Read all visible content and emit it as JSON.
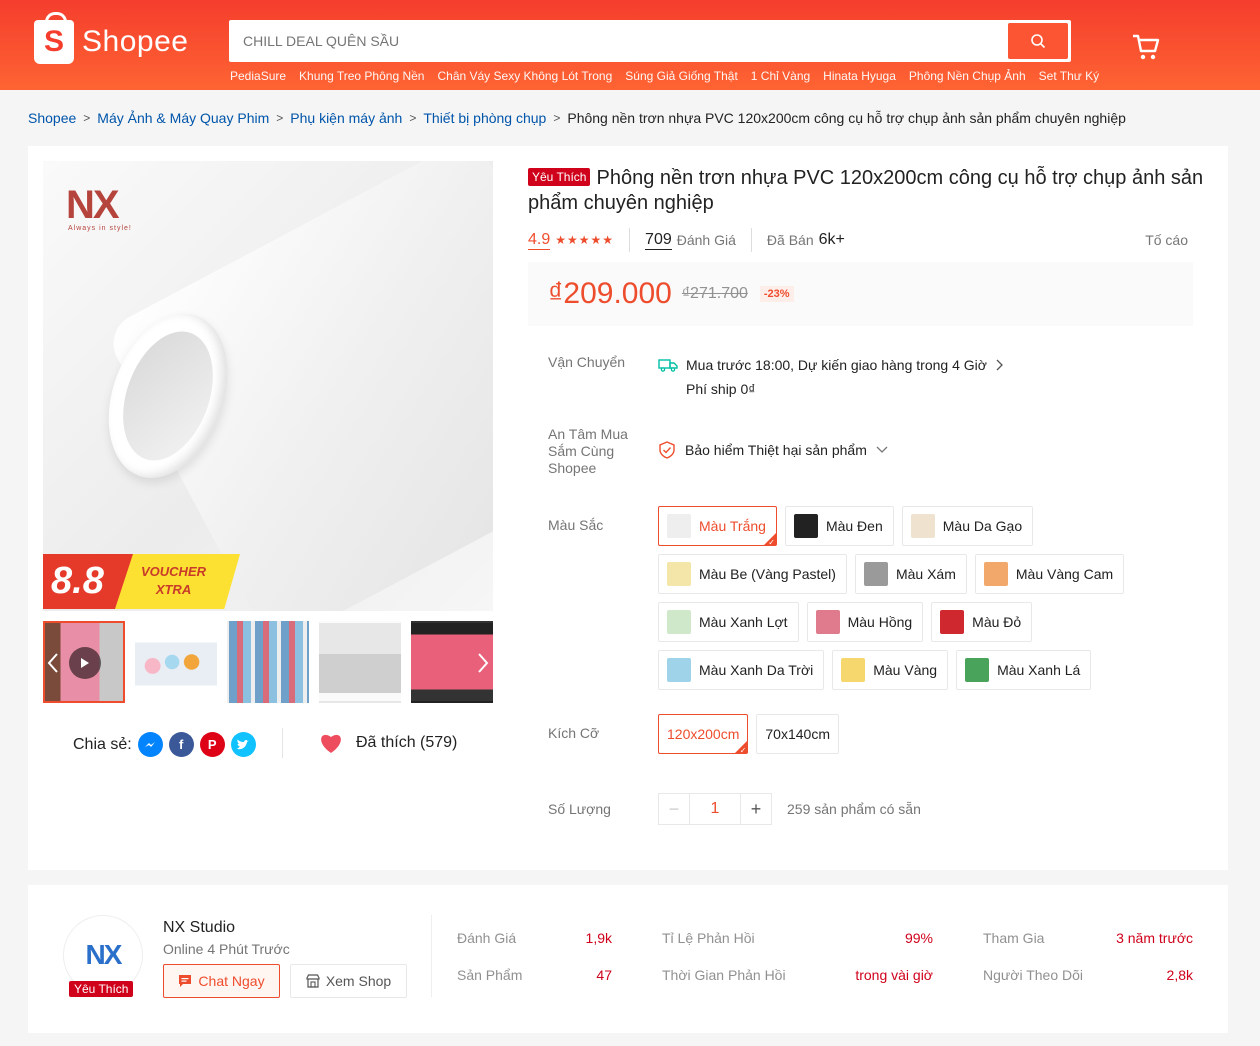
{
  "header": {
    "logo_text": "Shopee",
    "search_placeholder": "CHILL DEAL QUÊN SẦU",
    "suggestions": [
      "PediaSure",
      "Khung Treo Phông Nền",
      "Chân Váy Sexy Không Lót Trong",
      "Súng Giả Giống Thật",
      "1 Chỉ Vàng",
      "Hinata Hyuga",
      "Phông Nền Chụp Ảnh",
      "Set Thư Ký"
    ]
  },
  "breadcrumb": {
    "items": [
      "Shopee",
      "Máy Ảnh & Máy Quay Phim",
      "Phụ kiện máy ảnh",
      "Thiết bị phòng chụp"
    ],
    "current": "Phông nền trơn nhựa PVC 120x200cm công cụ hỗ trợ chụp ảnh sản phẩm chuyên nghiệp"
  },
  "gallery": {
    "brand_logo": "NX",
    "brand_tagline": "Always in style!",
    "voucher_number": "8.8",
    "voucher_line1": "VOUCHER",
    "voucher_line2": "XTRA"
  },
  "share": {
    "label": "Chia sẻ:",
    "liked_label": "Đã thích (579)"
  },
  "product": {
    "badge": "Yêu Thích",
    "title": "Phông nền trơn nhựa PVC 120x200cm công cụ hỗ trợ chụp ảnh sản phẩm chuyên nghiệp",
    "rating": "4.9",
    "stars": "★★★★★",
    "reviews_count": "709",
    "reviews_label": "Đánh Giá",
    "sold_label": "Đã Bán",
    "sold_count": "6k+",
    "report": "Tố cáo",
    "price": "₫209.000",
    "old_price": "₫271.700",
    "discount": "-23%"
  },
  "shipping": {
    "label": "Vận Chuyển",
    "line1": "Mua trước 18:00, Dự kiến giao hàng trong 4 Giờ",
    "line2": "Phí ship 0₫"
  },
  "insurance": {
    "label": "An Tâm Mua Sắm Cùng Shopee",
    "text": "Bảo hiểm Thiệt hại sản phẩm"
  },
  "colors": {
    "label": "Màu Sắc",
    "options": [
      {
        "name": "Màu Trắng",
        "swatch": "#eeeeee",
        "selected": true
      },
      {
        "name": "Màu Đen",
        "swatch": "#222222"
      },
      {
        "name": "Màu Da Gạo",
        "swatch": "#efe2cf"
      },
      {
        "name": "Màu Be (Vàng Pastel)",
        "swatch": "#f3e6a8"
      },
      {
        "name": "Màu Xám",
        "swatch": "#9a9a9a"
      },
      {
        "name": "Màu Vàng Cam",
        "swatch": "#f2a86a"
      },
      {
        "name": "Màu Xanh Lợt",
        "swatch": "#cfe8c9"
      },
      {
        "name": "Màu Hồng",
        "swatch": "#e07b8e"
      },
      {
        "name": "Màu Đỏ",
        "swatch": "#d0282f"
      },
      {
        "name": "Màu Xanh Da Trời",
        "swatch": "#9fd3ea"
      },
      {
        "name": "Màu Vàng",
        "swatch": "#f5d76e"
      },
      {
        "name": "Màu Xanh Lá",
        "swatch": "#4aa35a"
      }
    ]
  },
  "sizes": {
    "label": "Kích Cỡ",
    "options": [
      {
        "name": "120x200cm",
        "selected": true
      },
      {
        "name": "70x140cm"
      }
    ]
  },
  "quantity": {
    "label": "Số Lượng",
    "minus": "−",
    "value": "1",
    "plus": "+",
    "stock": "259 sản phẩm có sẵn"
  },
  "shop": {
    "name": "NX Studio",
    "online": "Online 4 Phút Trước",
    "badge": "Yêu Thích",
    "chat_btn": "Chat Ngay",
    "view_btn": "Xem Shop",
    "stats": [
      {
        "label": "Đánh Giá",
        "value": "1,9k"
      },
      {
        "label": "Sản Phẩm",
        "value": "47"
      },
      {
        "label": "Tỉ Lệ Phản Hồi",
        "value": "99%"
      },
      {
        "label": "Thời Gian Phản Hồi",
        "value": "trong vài giờ"
      },
      {
        "label": "Tham Gia",
        "value": "3 năm trước"
      },
      {
        "label": "Người Theo Dõi",
        "value": "2,8k"
      }
    ]
  },
  "colors_theme": {
    "accent": "#ee4d2d",
    "link": "#0055aa",
    "badge_red": "#d0011b"
  }
}
